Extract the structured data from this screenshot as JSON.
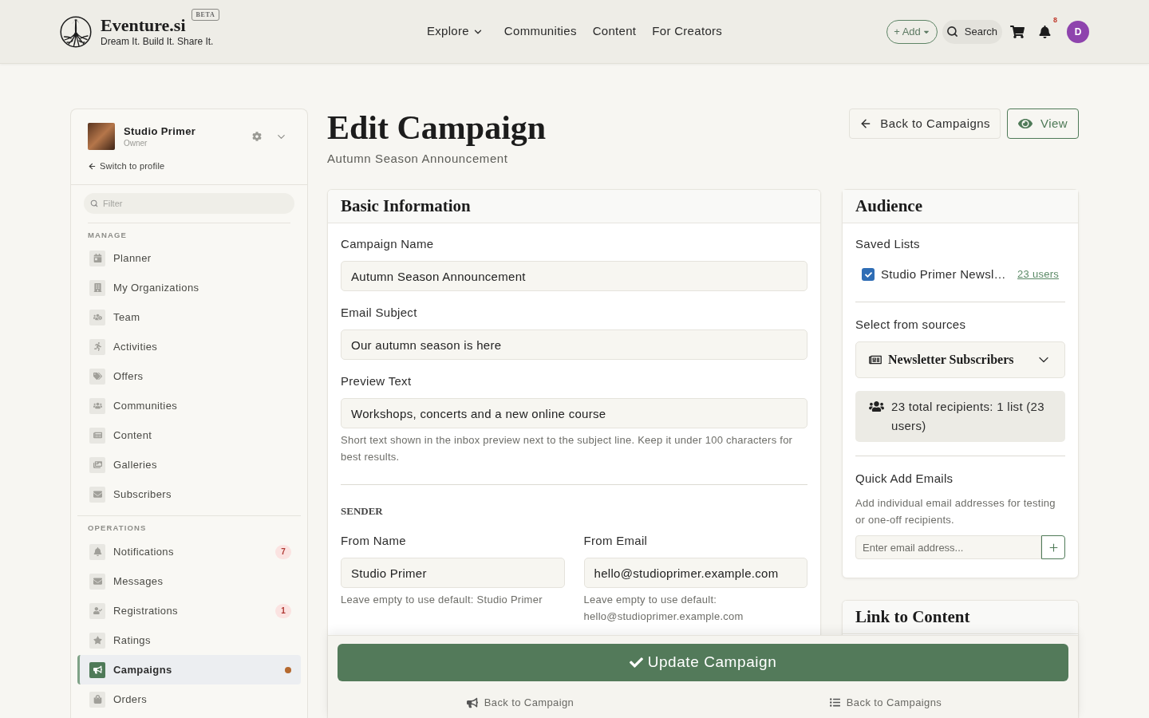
{
  "header": {
    "brand": {
      "name": "Eventure.si",
      "badge": "BETA",
      "tagline": "Dream It. Build It. Share It."
    },
    "nav": [
      {
        "label": "Explore",
        "kind": "dropdown"
      },
      {
        "label": "Communities",
        "kind": "link"
      },
      {
        "label": "Content",
        "kind": "link"
      },
      {
        "label": "For Creators",
        "kind": "link"
      }
    ],
    "add_button": "+ Add",
    "search_button": "Search",
    "notification_count": "8",
    "avatar": "D"
  },
  "sidebar": {
    "profile": {
      "name": "Studio Primer",
      "role": "Owner"
    },
    "switch_link": "Switch to profile",
    "filter": {
      "placeholder": "Filter"
    },
    "sections": [
      {
        "title": "MANAGE",
        "items": [
          {
            "label": "Planner",
            "selected": false,
            "dot": false
          },
          {
            "label": "My Organizations",
            "selected": false,
            "dot": false
          },
          {
            "label": "Team",
            "selected": false,
            "dot": false
          },
          {
            "label": "Activities",
            "selected": false,
            "dot": false
          },
          {
            "label": "Offers",
            "selected": false,
            "dot": false
          },
          {
            "label": "Communities",
            "selected": false,
            "dot": false
          },
          {
            "label": "Content",
            "selected": false,
            "dot": false
          },
          {
            "label": "Galleries",
            "selected": false,
            "dot": false
          },
          {
            "label": "Subscribers",
            "selected": false,
            "dot": false
          }
        ]
      },
      {
        "title": "OPERATIONS",
        "items": [
          {
            "label": "Notifications",
            "badge": "7",
            "selected": false,
            "dot": false
          },
          {
            "label": "Messages",
            "selected": false,
            "dot": false
          },
          {
            "label": "Registrations",
            "badge": "1",
            "selected": false,
            "dot": false
          },
          {
            "label": "Ratings",
            "selected": false,
            "dot": false
          },
          {
            "label": "Campaigns",
            "selected": true,
            "dot": true
          },
          {
            "label": "Orders",
            "selected": false,
            "dot": false
          }
        ]
      }
    ]
  },
  "page": {
    "title": "Edit Campaign",
    "subtitle": "Autumn Season Announcement",
    "actions": [
      {
        "label": "Back to Campaigns",
        "kind": "back"
      },
      {
        "label": "View",
        "kind": "view"
      }
    ]
  },
  "basic_information": {
    "title": "Basic Information",
    "fields": [
      {
        "label": "Campaign Name",
        "value": "Autumn Season Announcement"
      },
      {
        "label": "Email Subject",
        "value": "Our autumn season is here"
      },
      {
        "label": "Preview Text",
        "value": "Workshops, concerts and a new online course",
        "help": "Short text shown in the inbox preview next to the subject line. Keep it under 100 characters for best results."
      }
    ],
    "sender": {
      "title": "SENDER",
      "fields": [
        {
          "label": "From Name",
          "value": "Studio Primer",
          "help": "Leave empty to use default: Studio Primer"
        },
        {
          "label": "From Email",
          "value": "hello@studioprimer.example.com",
          "help": "Leave empty to use default: hello@studioprimer.example.com"
        }
      ]
    }
  },
  "audience": {
    "title": "Audience",
    "saved_lists": {
      "label": "Saved Lists",
      "items": [
        {
          "name": "Studio Primer Newsl…",
          "count": "23 users",
          "checked": true
        }
      ]
    },
    "sources": {
      "label": "Select from sources",
      "selected": "Newsletter Subscribers"
    },
    "summary": "23 total recipients: 1 list (23 users)",
    "quick_add": {
      "title": "Quick Add Emails",
      "help": "Add individual email addresses for testing or one-off recipients.",
      "placeholder": "Enter email address..."
    }
  },
  "link_to_content": {
    "title": "Link to Content"
  },
  "footer": {
    "submit": "Update Campaign",
    "links": [
      {
        "label": "Back to Campaign",
        "kind": "campaign"
      },
      {
        "label": "Back to Campaigns",
        "kind": "list"
      }
    ]
  }
}
